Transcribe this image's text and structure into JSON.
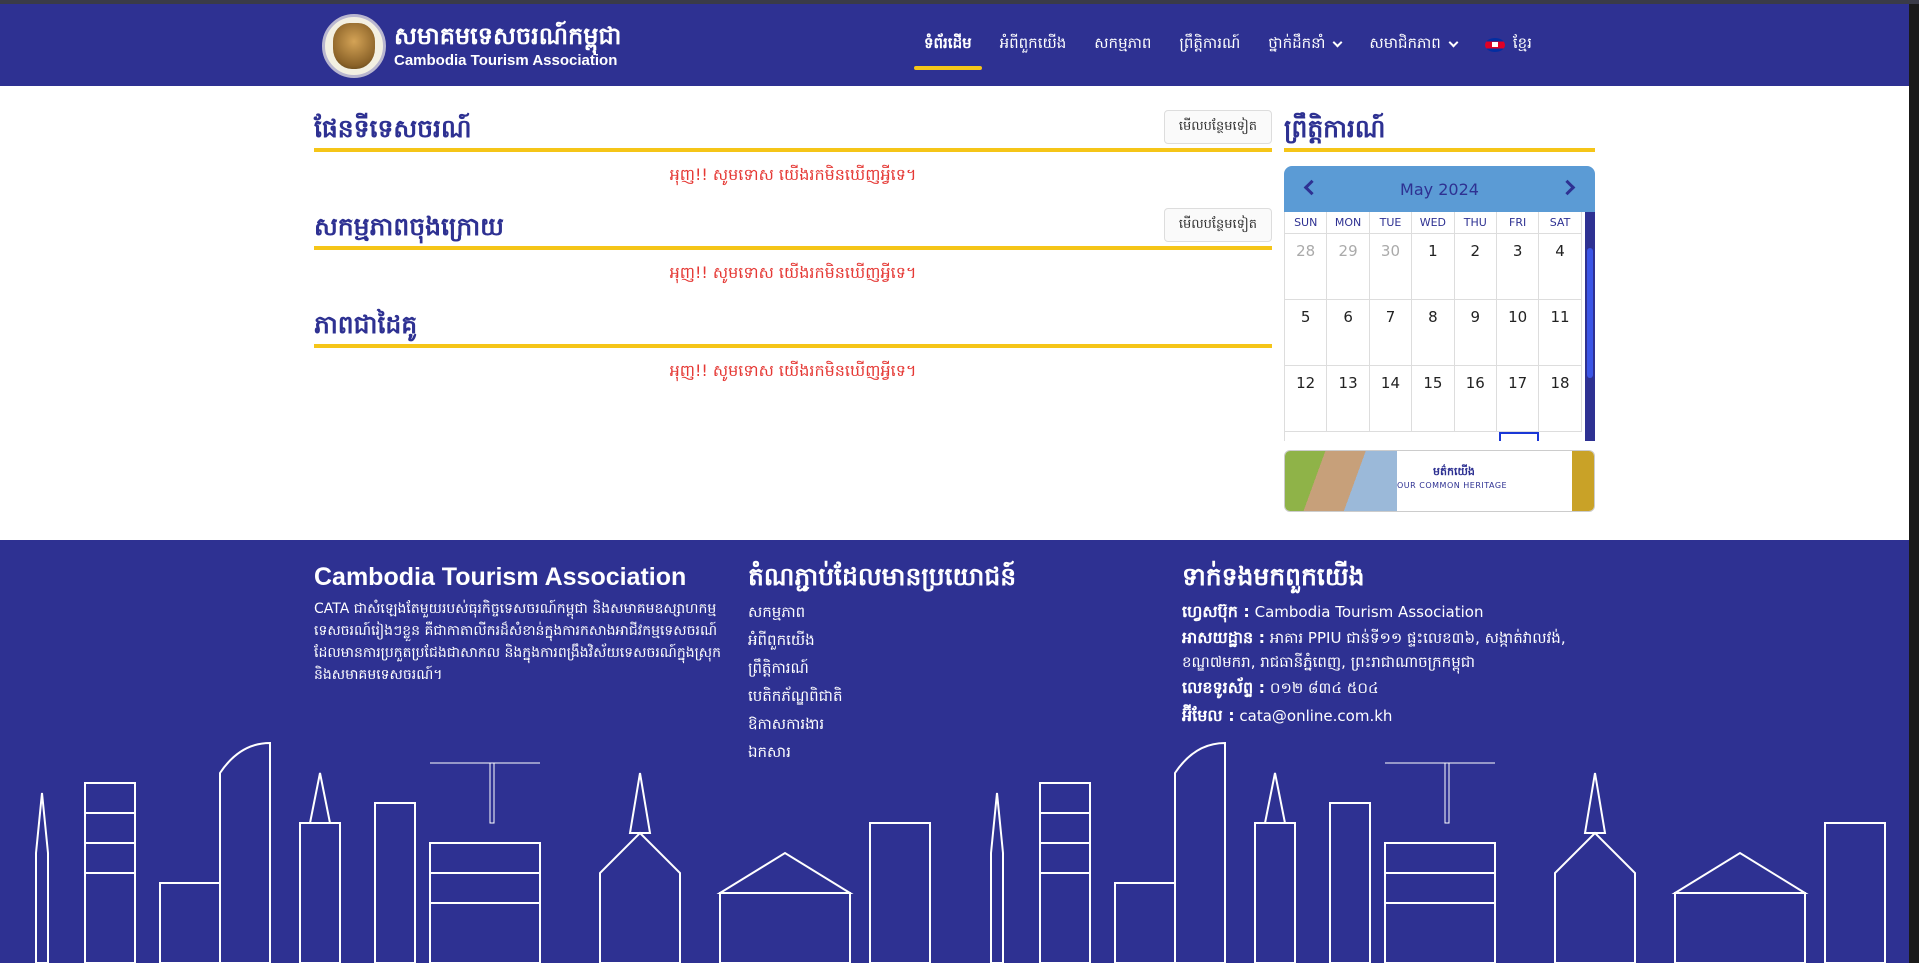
{
  "header": {
    "logo_title_km": "សមាគមទេសចរណ៍កម្ពុជា",
    "logo_title_en": "Cambodia Tourism Association",
    "nav": [
      {
        "label": "ទំព័រដើម",
        "active": true
      },
      {
        "label": "អំពីពួកយើង"
      },
      {
        "label": "សកម្មភាព"
      },
      {
        "label": "ព្រឹត្តិការណ៍"
      },
      {
        "label": "ថ្នាក់ដឹកនាំ",
        "dropdown": true
      },
      {
        "label": "សមាជិកភាព",
        "dropdown": true
      },
      {
        "label": "ខ្មែរ",
        "flag": "cambodia-flag-icon"
      }
    ]
  },
  "sections": [
    {
      "title": "ផែនទីទេសចរណ៍",
      "more": "មើលបន្ថែមទៀត",
      "empty": "អុញ!! សូមទោស យើងរកមិនឃើញអ្វីទេ។"
    },
    {
      "title": "សកម្មភាពចុងក្រោយ",
      "more": "មើលបន្ថែមទៀត",
      "empty": "អុញ!! សូមទោស យើងរកមិនឃើញអ្វីទេ។"
    },
    {
      "title": "ភាពជាដៃគូ",
      "empty": "អុញ!! សូមទោស យើងរកមិនឃើញអ្វីទេ។"
    }
  ],
  "events": {
    "title": "ព្រឹត្តិការណ៍",
    "calendar": {
      "month": "May 2024",
      "weekdays": [
        "SUN",
        "MON",
        "TUE",
        "WED",
        "THU",
        "FRI",
        "SAT"
      ],
      "days": [
        "28",
        "29",
        "30",
        "1",
        "2",
        "3",
        "4",
        "5",
        "6",
        "7",
        "8",
        "9",
        "10",
        "11",
        "12",
        "13",
        "14",
        "15",
        "16",
        "17",
        "18"
      ],
      "other_month_count": 3
    },
    "banner": {
      "text_en": "OUR COMMON HERITAGE",
      "text_km": "មត៌កយើង"
    }
  },
  "footer": {
    "about_title": "Cambodia Tourism Association",
    "about_text": "CATA ជាសំឡេងតែមួយរបស់ធុរកិច្ចទេសចរណ៍កម្ពុជា និងសមាគមឧស្សាហកម្មទេសចរណ៍រៀងៗខ្លួន គឺជាកាតាលីករដ៏សំខាន់ក្នុងការកសាងអាជីវកម្មទេសចរណ៍ដែលមានការប្រកួតប្រជែងជាសាកល និងក្នុងការពង្រឹងវិស័យទេសចរណ៍ក្នុងស្រុក និងសមាគមទេសចរណ៍។",
    "links_title": "តំណភ្ជាប់ដែលមានប្រយោជន៍",
    "links": [
      "សកម្មភាព",
      "អំពីពួកយើង",
      "ព្រឹត្តិការណ៍",
      "បេតិកភ័ណ្ឌពិជាតិ",
      "ឱកាសការងារ",
      "ឯកសារ"
    ],
    "contact_title": "ទាក់ទងមកពួកយើង",
    "contact": [
      {
        "label": "ហ្វេសប៊ុក :",
        "value": "Cambodia Tourism Association"
      },
      {
        "label": "អាសយដ្ឋាន :",
        "value": "អាគារ PPIU ជាន់ទី១១ ផ្ទះលេខ៣៦, សង្កាត់វាលវង់, ខណ្ឌ៧មករា, រាជធានីភ្នំពេញ, ព្រះរាជាណាចក្រកម្ពុជា"
      },
      {
        "label": "លេខទូរស័ព្ទ :",
        "value": "០១២ ៨៣៤ ៥០៤"
      },
      {
        "label": "អ៊ីមែល :",
        "value": "cata@online.com.kh"
      }
    ]
  }
}
